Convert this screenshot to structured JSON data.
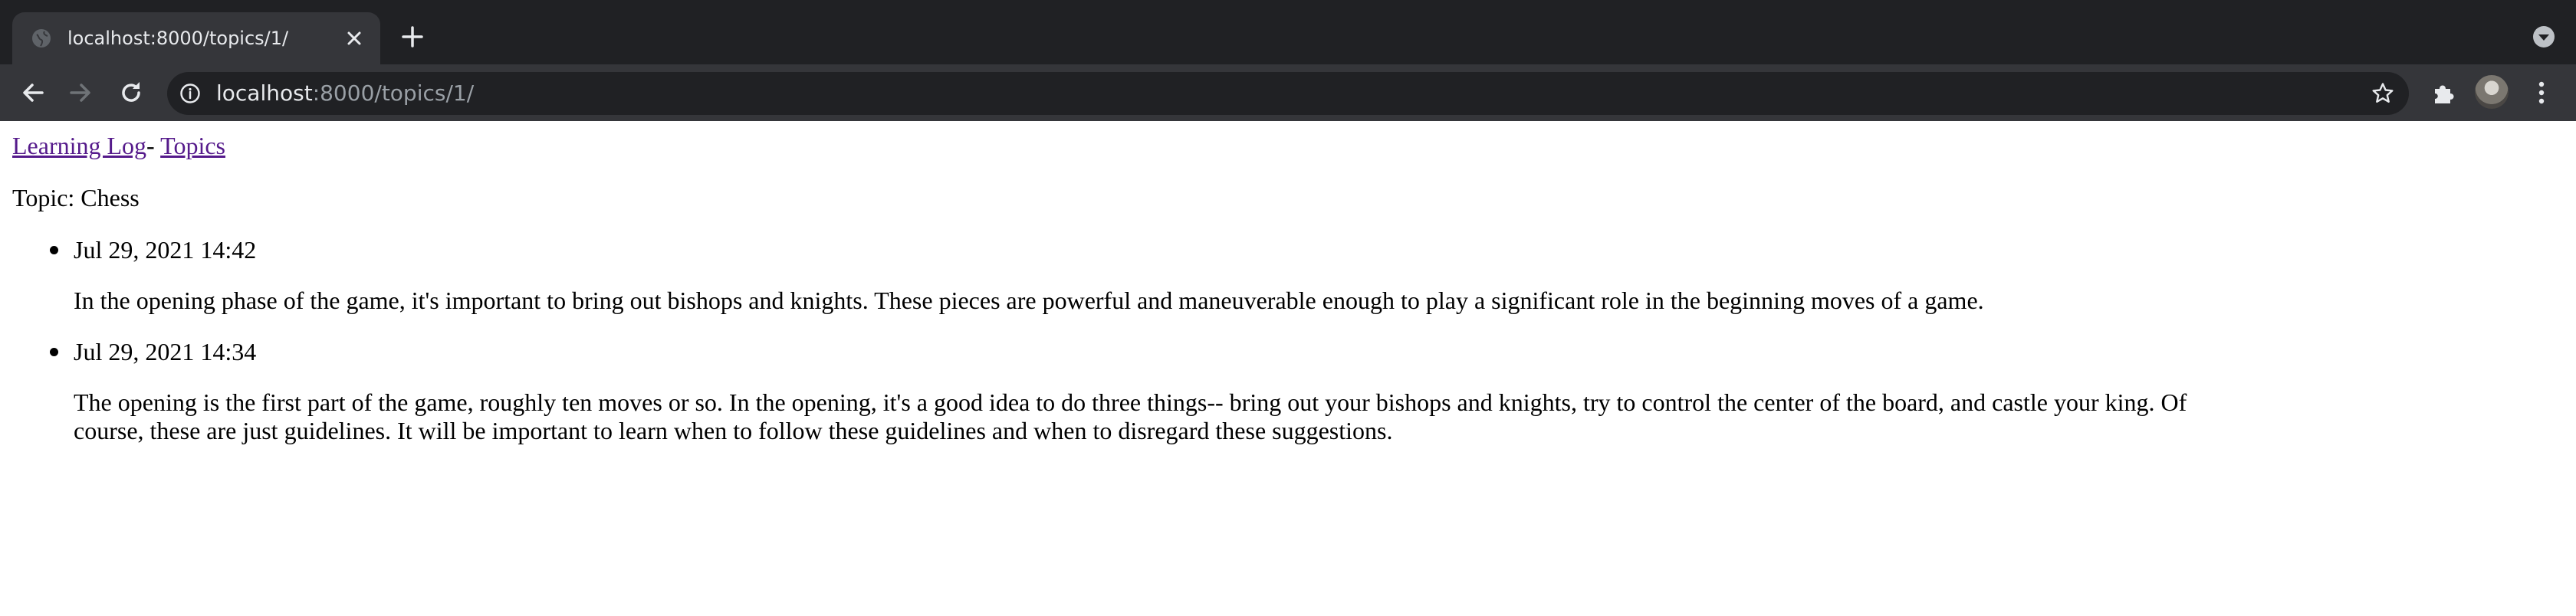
{
  "browser": {
    "tab": {
      "title": "localhost:8000/topics/1/"
    },
    "address_bar": {
      "host": "localhost",
      "path": ":8000/topics/1/"
    }
  },
  "page": {
    "nav": {
      "home_link": "Learning Log",
      "separator": "- ",
      "topics_link": "Topics"
    },
    "topic_heading": "Topic: Chess",
    "entries": [
      {
        "date": "Jul 29, 2021 14:42",
        "text": "In the opening phase of the game, it's important to bring out bishops and knights. These pieces are powerful and maneuverable enough to play a significant role in the beginning moves of a game."
      },
      {
        "date": "Jul 29, 2021 14:34",
        "text": "The opening is the first part of the game, roughly ten moves or so. In the opening, it's a good idea to do three things-- bring out your bishops and knights, try to control the center of the board, and castle your king. Of course, these are just guidelines. It will be important to learn when to follow these guidelines and when to disregard these suggestions."
      }
    ]
  },
  "colors": {
    "chrome_dark": "#202124",
    "chrome_tab": "#35363a",
    "chrome_text": "#e8eaed",
    "chrome_muted_text": "#9aa0a6",
    "visited_link": "#551a8b"
  }
}
